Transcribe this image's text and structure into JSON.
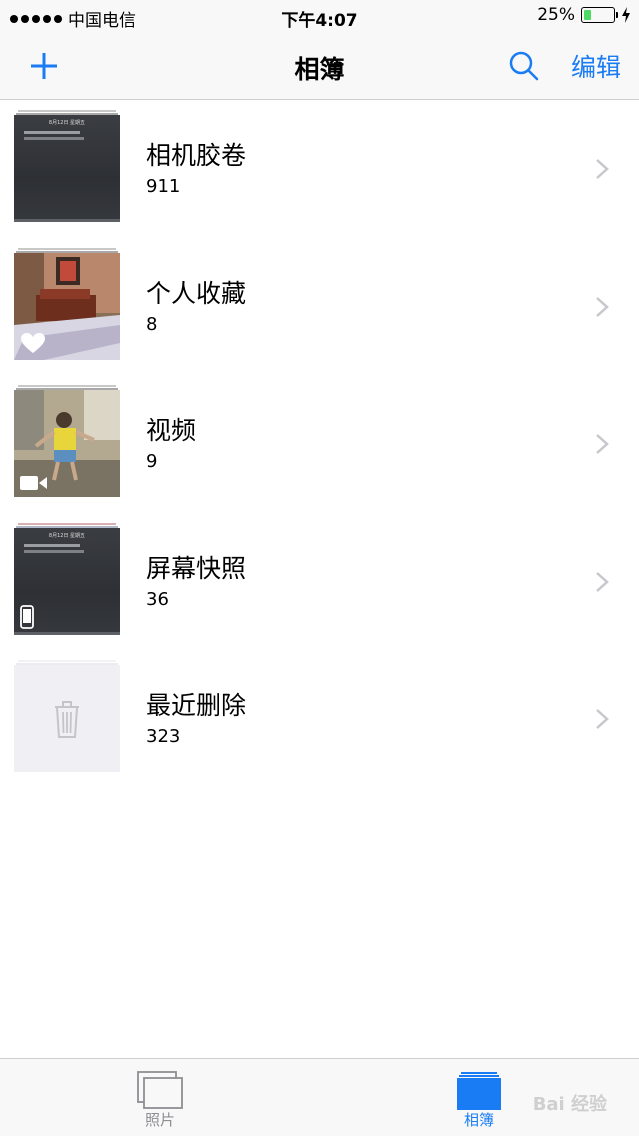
{
  "status_bar": {
    "carrier": "中国电信",
    "time": "下午4:07",
    "battery": "25%",
    "battery_level": 0.25
  },
  "nav": {
    "title": "相簿",
    "edit_label": "编辑",
    "add_icon": "plus-icon",
    "search_icon": "search-icon"
  },
  "albums": [
    {
      "name": "相机胶卷",
      "count": "911",
      "thumb_date": "8月12日 星期五"
    },
    {
      "name": "个人收藏",
      "count": "8"
    },
    {
      "name": "视频",
      "count": "9"
    },
    {
      "name": "屏幕快照",
      "count": "36",
      "thumb_date": "8月12日 星期五"
    },
    {
      "name": "最近删除",
      "count": "323"
    }
  ],
  "tab_bar": {
    "tabs": [
      {
        "label": "照片",
        "icon": "photos-icon",
        "selected": false
      },
      {
        "label": "相簿",
        "icon": "albums-icon",
        "selected": true
      }
    ]
  },
  "watermark": "Bai 经验",
  "colors": {
    "accent": "#1a7cf4",
    "battery_green": "#4cd964",
    "inactive_gray": "#8e8e93"
  }
}
